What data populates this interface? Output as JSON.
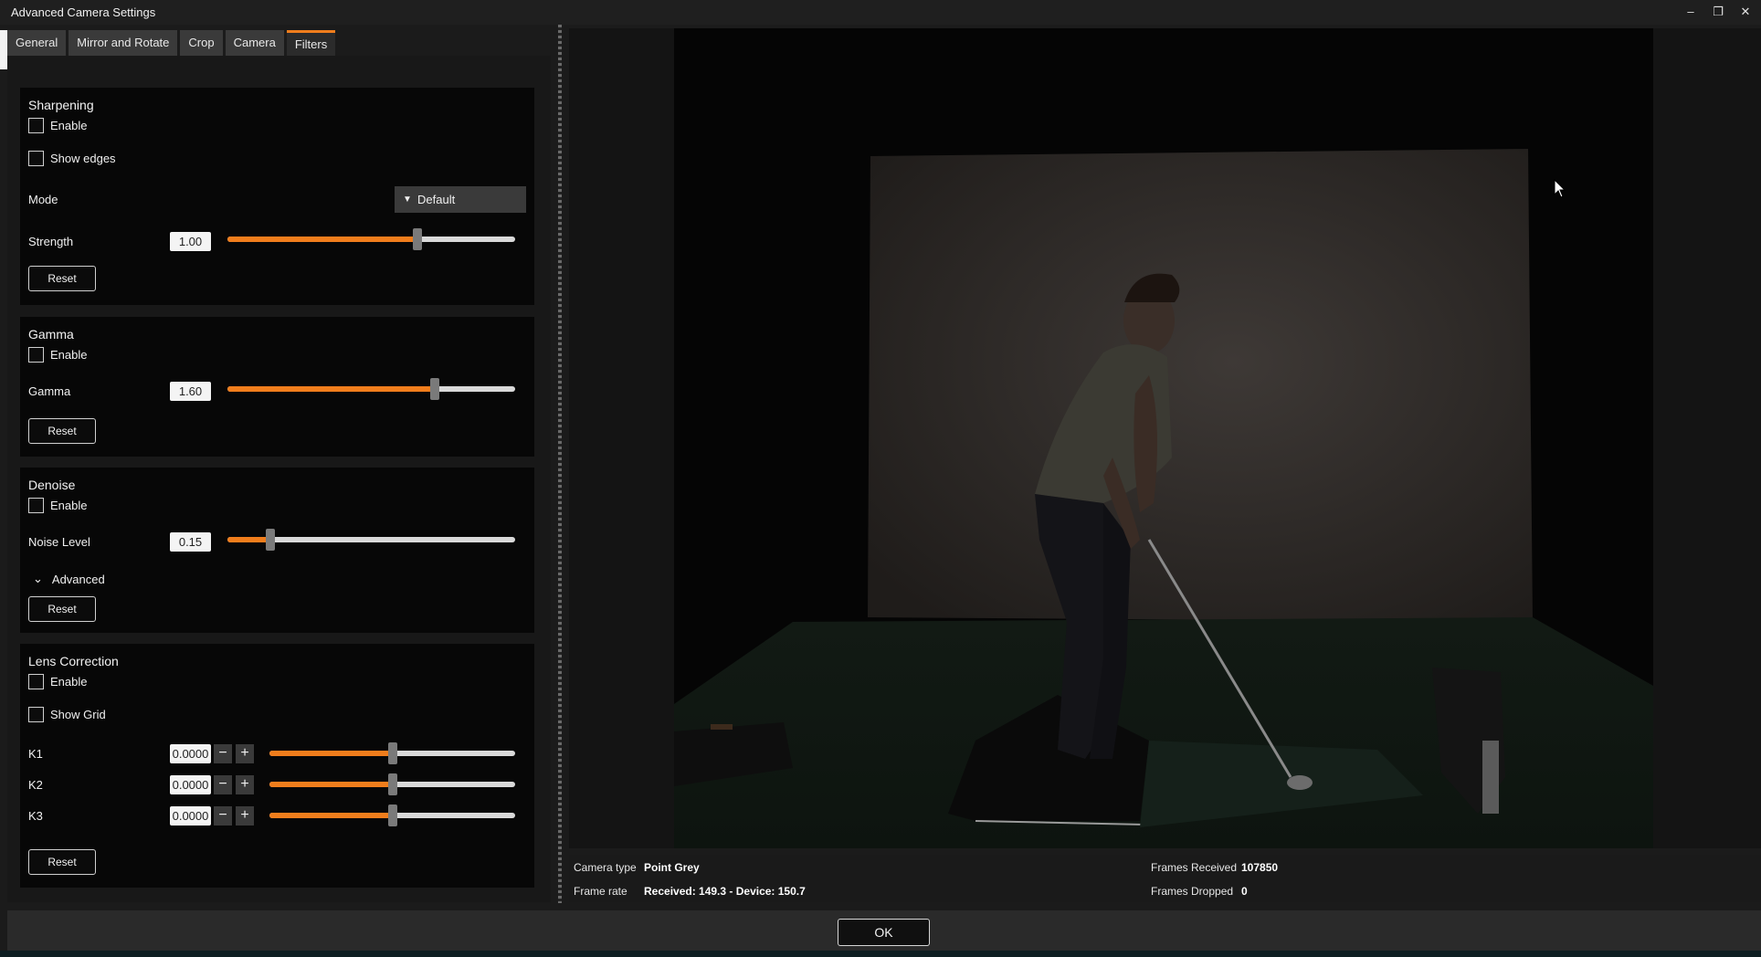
{
  "window": {
    "title": "Advanced Camera Settings",
    "minimize_glyph": "‒",
    "restore_glyph": "❐",
    "close_glyph": "✕"
  },
  "tabs": [
    {
      "label": "General"
    },
    {
      "label": "Mirror and Rotate"
    },
    {
      "label": "Crop"
    },
    {
      "label": "Camera"
    },
    {
      "label": "Filters",
      "active": true
    }
  ],
  "accent_color": "#f07d1c",
  "sharpening": {
    "title": "Sharpening",
    "enable_label": "Enable",
    "enable_checked": false,
    "show_edges_label": "Show edges",
    "show_edges_checked": false,
    "mode_label": "Mode",
    "mode_value": "Default",
    "strength_label": "Strength",
    "strength_value": "1.00",
    "strength_slider_fraction": 0.66,
    "reset_label": "Reset"
  },
  "gamma": {
    "title": "Gamma",
    "enable_label": "Enable",
    "enable_checked": false,
    "gamma_label": "Gamma",
    "gamma_value": "1.60",
    "gamma_slider_fraction": 0.72,
    "reset_label": "Reset"
  },
  "denoise": {
    "title": "Denoise",
    "enable_label": "Enable",
    "enable_checked": false,
    "noise_label": "Noise Level",
    "noise_value": "0.15",
    "noise_slider_fraction": 0.15,
    "advanced_label": "Advanced",
    "reset_label": "Reset"
  },
  "lens": {
    "title": "Lens Correction",
    "enable_label": "Enable",
    "enable_checked": false,
    "show_grid_label": "Show Grid",
    "show_grid_checked": false,
    "coefficients": [
      {
        "label": "K1",
        "value": "0.0000",
        "slider_fraction": 0.5
      },
      {
        "label": "K2",
        "value": "0.0000",
        "slider_fraction": 0.5
      },
      {
        "label": "K3",
        "value": "0.0000",
        "slider_fraction": 0.5
      }
    ],
    "minus_glyph": "−",
    "plus_glyph": "+",
    "reset_label": "Reset"
  },
  "status": {
    "camera_type_label": "Camera type",
    "camera_type_value": "Point Grey",
    "frame_rate_label": "Frame rate",
    "frame_rate_value": "Received: 149.3 - Device: 150.7",
    "frames_received_label": "Frames Received",
    "frames_received_value": "107850",
    "frames_dropped_label": "Frames Dropped",
    "frames_dropped_value": "0"
  },
  "ok_label": "OK"
}
